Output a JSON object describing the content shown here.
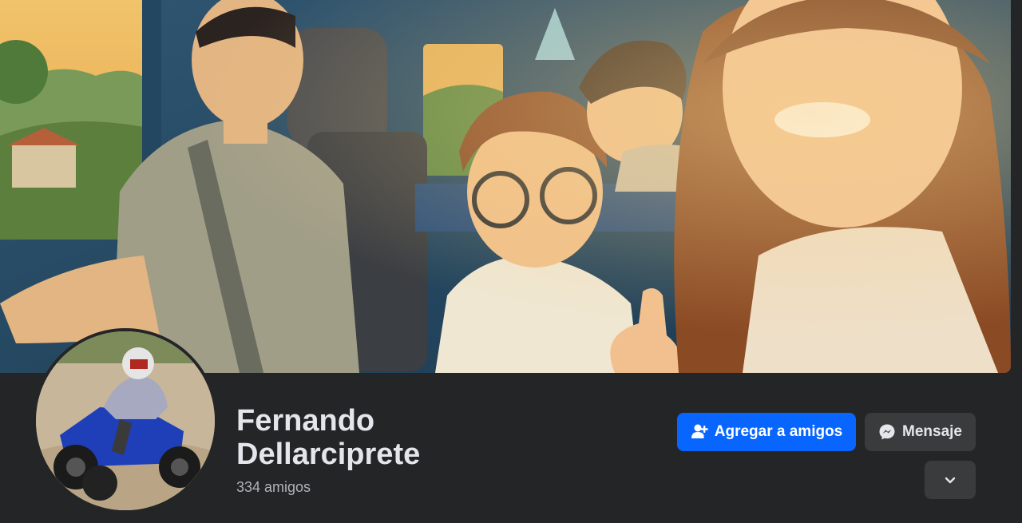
{
  "profile": {
    "name_line1": "Fernando",
    "name_line2": "Dellarciprete",
    "friends_count": "334 amigos"
  },
  "actions": {
    "add_friend_label": "Agregar a amigos",
    "add_friend_icon": "person-add-icon",
    "message_label": "Mensaje",
    "message_icon": "messenger-icon",
    "more_icon": "chevron-down-icon"
  },
  "colors": {
    "page_bg": "#242526",
    "primary_button": "#0866ff",
    "secondary_button": "#3a3b3c",
    "text_primary": "#e4e6eb",
    "text_secondary": "#b0b3b8"
  }
}
